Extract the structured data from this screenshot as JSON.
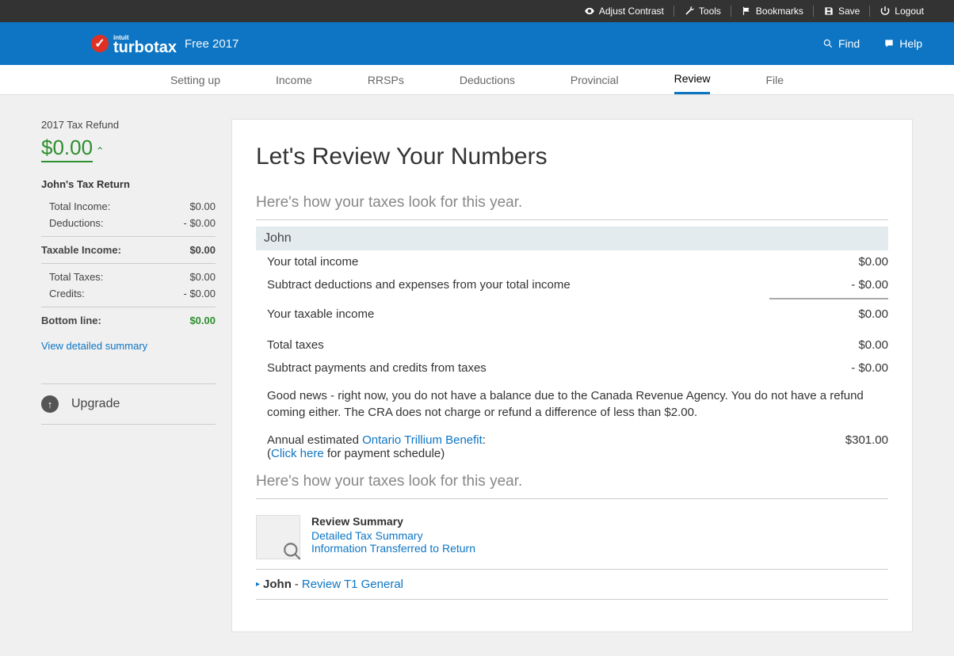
{
  "topbar": {
    "adjust_contrast": "Adjust Contrast",
    "tools": "Tools",
    "bookmarks": "Bookmarks",
    "save": "Save",
    "logout": "Logout"
  },
  "header": {
    "brand_small": "intuit",
    "brand": "turbotax",
    "edition": "Free 2017",
    "find": "Find",
    "help": "Help"
  },
  "nav": {
    "setting_up": "Setting up",
    "income": "Income",
    "rrsps": "RRSPs",
    "deductions": "Deductions",
    "provincial": "Provincial",
    "review": "Review",
    "file": "File"
  },
  "sidebar": {
    "refund_label": "2017 Tax Refund",
    "refund_amount": "$0.00",
    "return_name": "John's Tax Return",
    "rows": {
      "total_income_label": "Total Income:",
      "total_income_val": "$0.00",
      "deductions_label": "Deductions:",
      "deductions_val": "- $0.00",
      "taxable_income_label": "Taxable Income:",
      "taxable_income_val": "$0.00",
      "total_taxes_label": "Total Taxes:",
      "total_taxes_val": "$0.00",
      "credits_label": "Credits:",
      "credits_val": "- $0.00",
      "bottom_line_label": "Bottom line:",
      "bottom_line_val": "$0.00"
    },
    "view_detailed": "View detailed summary",
    "upgrade": "Upgrade"
  },
  "main": {
    "title": "Let's Review Your Numbers",
    "subhead1": "Here's how your taxes look for this year.",
    "person": "John",
    "rows": {
      "total_income_l": "Your total income",
      "total_income_v": "$0.00",
      "subtract_ded_l": "Subtract deductions and expenses from your total income",
      "subtract_ded_v": "- $0.00",
      "taxable_l": "Your taxable income",
      "taxable_v": "$0.00",
      "total_taxes_l": "Total taxes",
      "total_taxes_v": "$0.00",
      "subtract_credits_l": "Subtract payments and credits from taxes",
      "subtract_credits_v": "- $0.00"
    },
    "goodnews": "Good news - right now, you do not have a balance due to the Canada Revenue Agency. You do not have a refund coming either. The CRA does not charge or refund a difference of less than $2.00.",
    "otb_prefix": "Annual estimated ",
    "otb_link": "Ontario Trillium Benefit",
    "otb_suffix": ":",
    "otb_click_here": "Click here",
    "otb_schedule": " for payment schedule)",
    "otb_paren_open": "(",
    "otb_value": "$301.00",
    "subhead2": "Here's how your taxes look for this year.",
    "review_summary_title": "Review Summary",
    "detailed_tax_summary": "Detailed Tax Summary",
    "info_transferred": "Information Transferred to Return",
    "person_review_name": "John",
    "person_review_sep": " - ",
    "review_t1": "Review T1 General"
  }
}
